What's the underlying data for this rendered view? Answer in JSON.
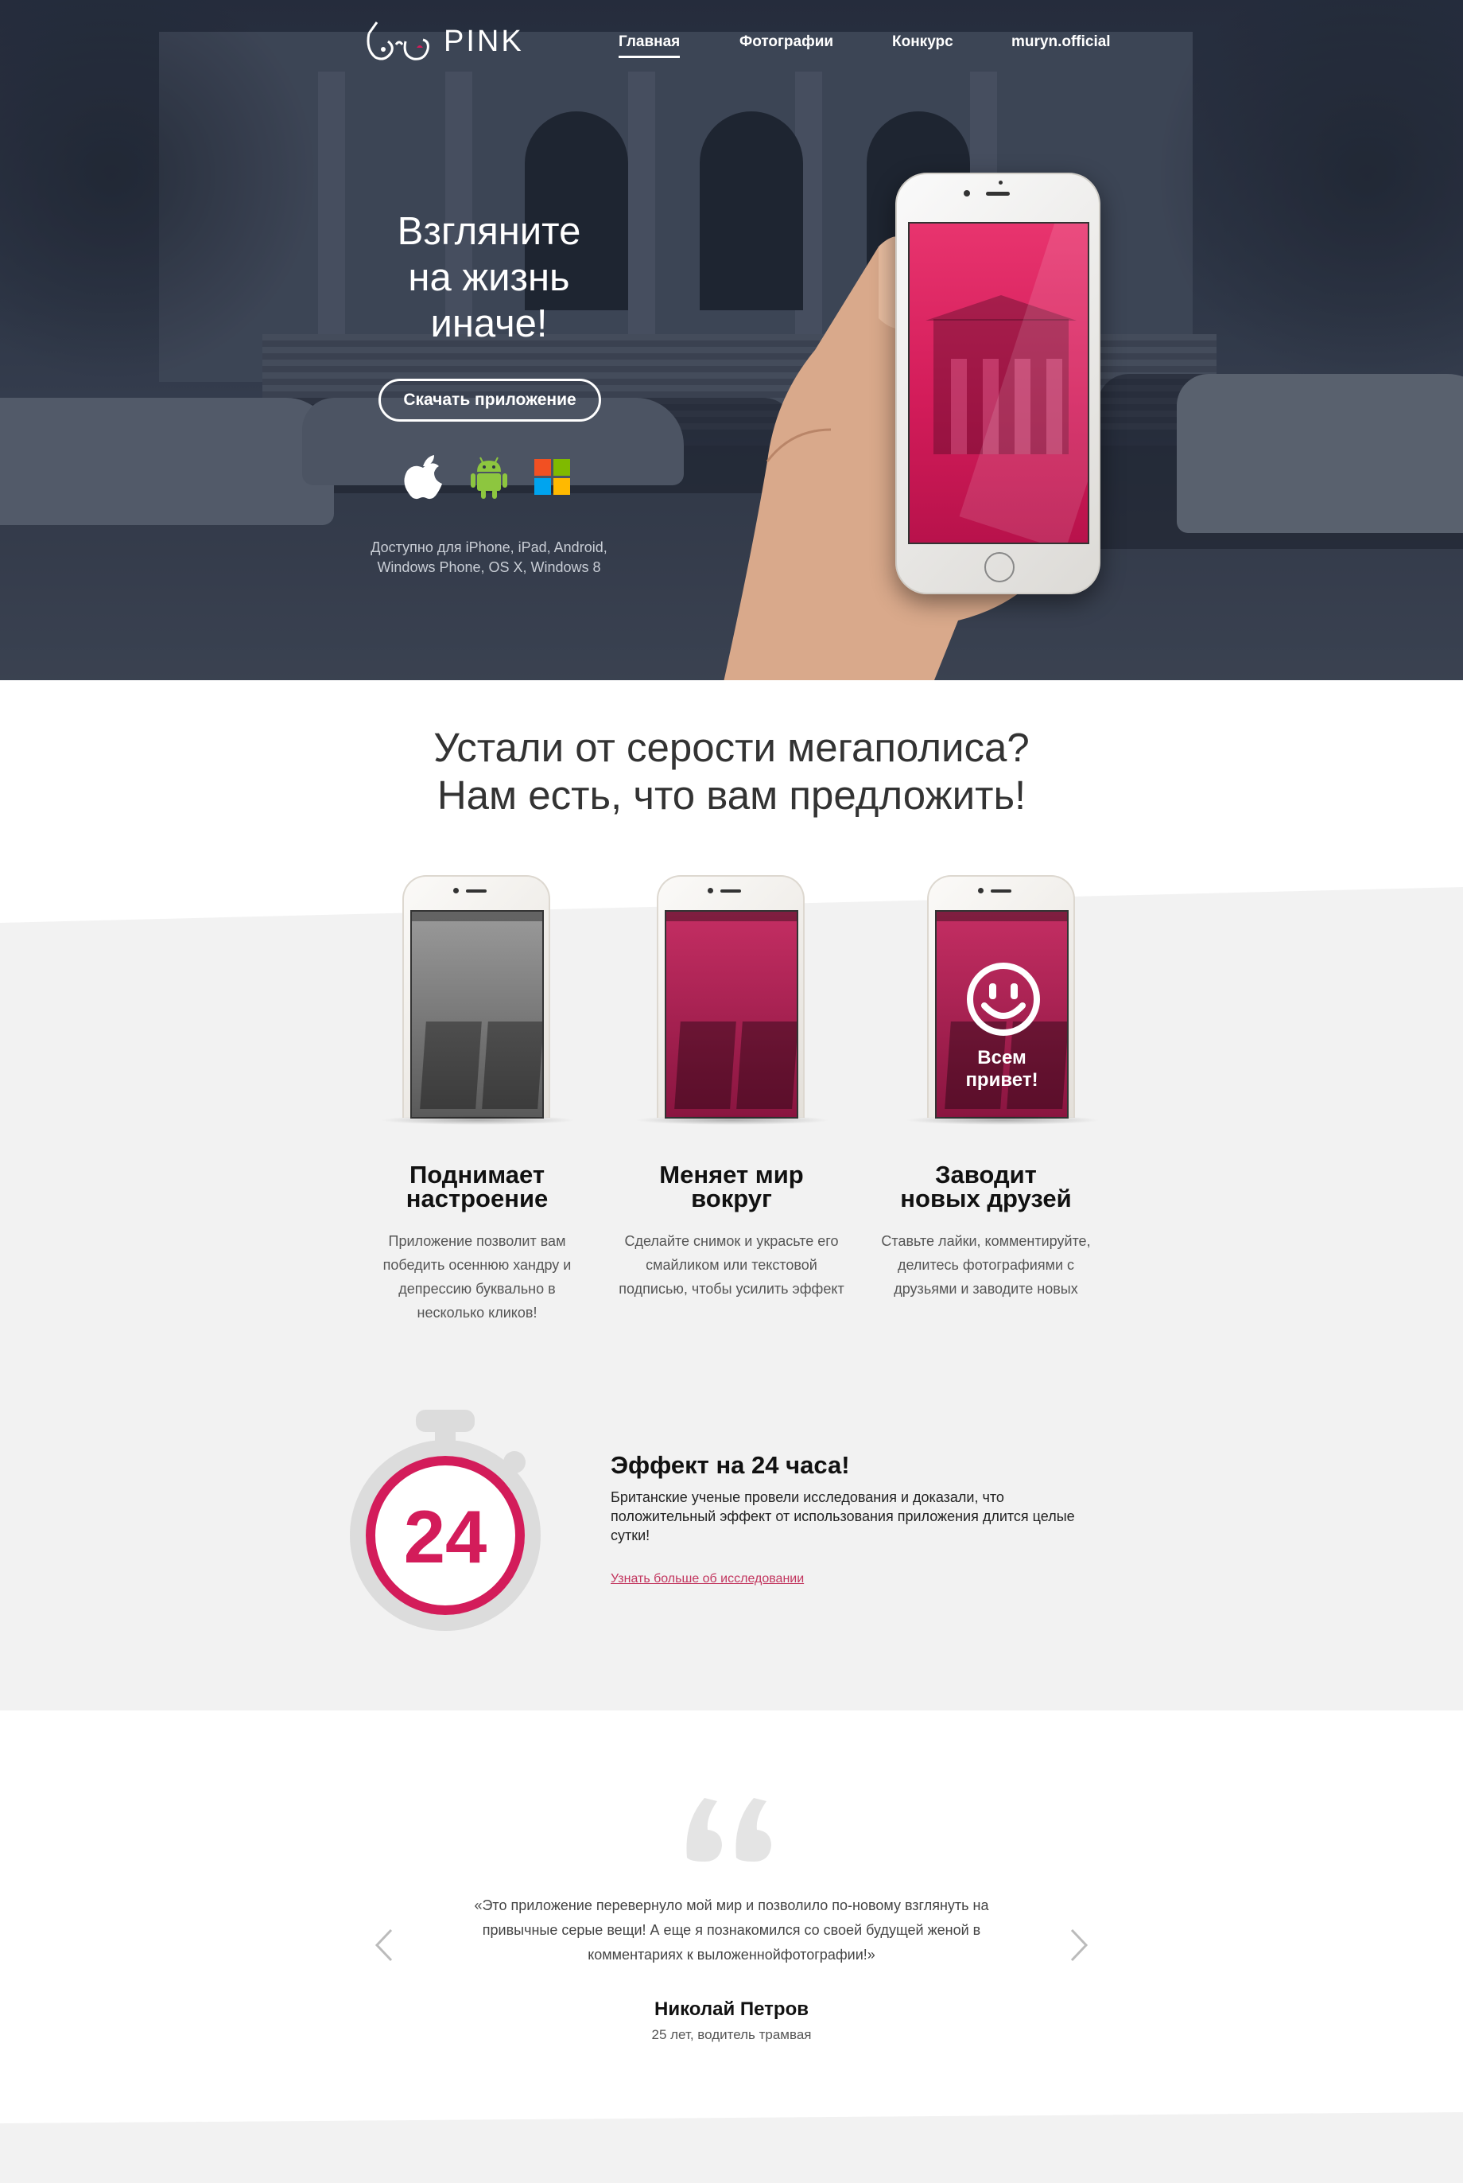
{
  "header": {
    "logo_text": "PINK",
    "nav": [
      {
        "label": "Главная",
        "active": true
      },
      {
        "label": "Фотографии",
        "active": false
      },
      {
        "label": "Конкурс",
        "active": false
      },
      {
        "label": "muryn.official",
        "active": false
      }
    ]
  },
  "hero": {
    "title_lines": [
      "Взгляните",
      "на жизнь",
      "иначе!"
    ],
    "download_button": "Скачать приложение",
    "platform_icons": [
      "apple-icon",
      "android-icon",
      "windows-icon"
    ],
    "availability_lines": [
      "Доступно для iPhone, iPad, Android,",
      "Windows Phone, OS X, Windows 8"
    ]
  },
  "features": {
    "heading_lines": [
      "Устали от серости мегаполиса?",
      "Нам есть, что вам предложить!"
    ],
    "items": [
      {
        "title_lines": [
          "Поднимает",
          "настроение"
        ],
        "text_lines": [
          "Приложение позволит вам",
          "победить осеннюю хандру и",
          "депрессию буквально в",
          "несколько кликов!"
        ]
      },
      {
        "title_lines": [
          "Меняет мир",
          "вокруг"
        ],
        "text_lines": [
          "Сделайте снимок и украсьте его",
          "смайликом или текстовой",
          "подписью, чтобы усилить эффект"
        ]
      },
      {
        "title_lines": [
          "Заводит",
          "новых друзей"
        ],
        "text_lines": [
          "Ставьте лайки, комментируйте,",
          "делитесь фотографиями с",
          "друзьями и заводите новых"
        ]
      }
    ],
    "phone_caption_lines": [
      "Всем",
      "привет!"
    ]
  },
  "effect": {
    "timer_number": "24",
    "title": "Эффект на 24 часа!",
    "text_lines": [
      "Британские ученые провели исследования и доказали, что",
      "положительный эффект от использования приложения длится целые",
      "сутки!"
    ],
    "link": "Узнать больше об исследовании"
  },
  "review": {
    "text_lines": [
      "«Это приложение перевернуло мой мир и позволило по-новому взглянуть на",
      "привычные серые вещи! А еще я познакомился со своей будущей женой в",
      "комментариях к выложеннойфотографии!»"
    ],
    "name": "Николай Петров",
    "role": "25 лет, водитель трамвая"
  },
  "colors": {
    "accent": "#d31c5a",
    "link": "#c2355e",
    "hero_bg": "#2f3644",
    "gray_bg": "#f2f2f2"
  }
}
